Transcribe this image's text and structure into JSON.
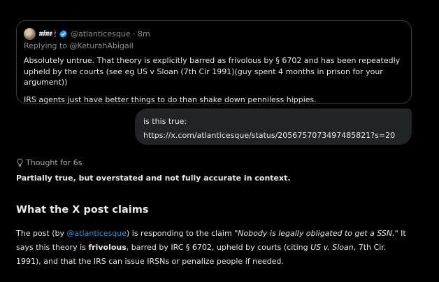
{
  "tweet": {
    "display_name": "𝖓𝖎𝖓𝖊",
    "flame": "🕯",
    "handle_meta": "@atlanticesque · 8m",
    "replying_to": "Replying to @KeturahAbigail",
    "paragraph_1": "Absolutely untrue. That theory is explicitly barred as frivolous by § 6702 and has been repeatedly upheld by the courts (see eg US v Sloan (7th Cir 1991)(guy spent 4 months in prison for your argument))",
    "paragraph_2": "IRS agents just have better things to do than shake down penniless hippies."
  },
  "user_message": {
    "line_1": "is this true:",
    "line_2": "https://x.com/atlanticesque/status/2056757073497485821?s=20"
  },
  "thought": {
    "label": "Thought for 6s"
  },
  "summary": "Partially true, but overstated and not fully accurate in context.",
  "section": {
    "title": "What the X post claims"
  },
  "answer": {
    "t1": "The post (by ",
    "link": "@atlanticesque",
    "t2": ") is responding to the claim ",
    "quote": "\"Nobody is legally obligated to get a SSN.\"",
    "t3": " It says this theory is ",
    "bold": "frivolous",
    "t4": ", barred by IRC § 6702, upheld by courts (citing ",
    "case": "US v. Sloan",
    "t5": ", 7th Cir. 1991), and that the IRS can issue IRSNs or penalize people if needed."
  },
  "colors": {
    "background": "#000000",
    "bubble": "#222327",
    "link": "#1d9bf0",
    "verified": "#1d9bf0",
    "muted_text": "#8b9096"
  },
  "icons": [
    "avatar",
    "candle-icon",
    "verified-badge-icon",
    "lightbulb-icon"
  ]
}
